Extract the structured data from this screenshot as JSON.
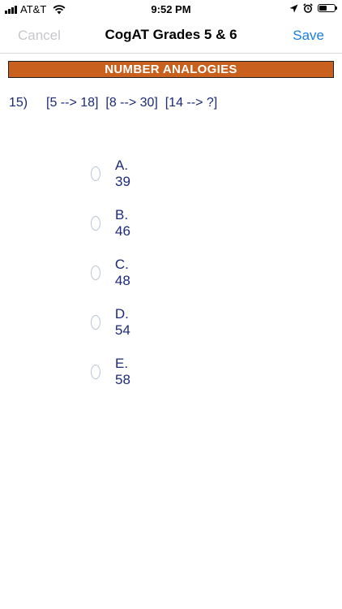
{
  "status_bar": {
    "carrier": "AT&T",
    "time": "9:52 PM",
    "icons": [
      "signal-icon",
      "wifi-icon",
      "location-arrow-icon",
      "alarm-icon",
      "battery-icon"
    ]
  },
  "nav": {
    "cancel_label": "Cancel",
    "title": "CogAT Grades 5 & 6",
    "save_label": "Save"
  },
  "section": {
    "title": "NUMBER ANALOGIES",
    "color": "#c9601e"
  },
  "question": {
    "number": "15)",
    "text": "[5 --> 18]  [8 --> 30]  [14 --> ?]"
  },
  "options": [
    {
      "label": "A. 39"
    },
    {
      "label": "B. 46"
    },
    {
      "label": "C. 48"
    },
    {
      "label": "D. 54"
    },
    {
      "label": "E. 58"
    }
  ],
  "colors": {
    "accent": "#1a7ee6",
    "text_dark_blue": "#1c2a78"
  }
}
